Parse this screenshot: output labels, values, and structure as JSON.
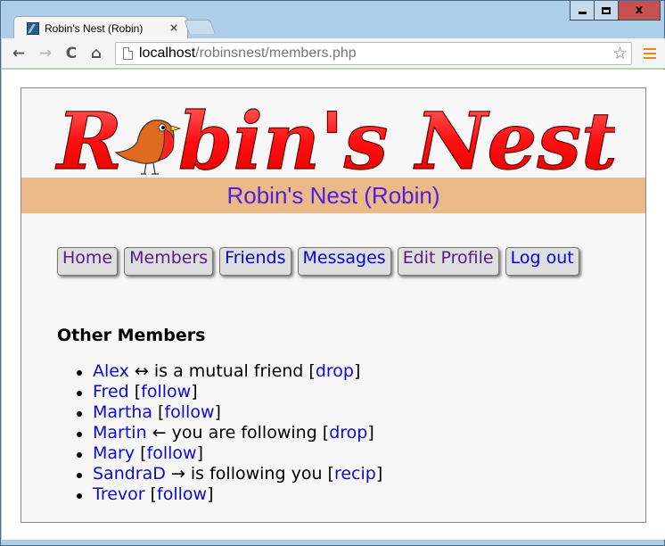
{
  "window": {
    "controls": {
      "minimize": "minimize",
      "maximize": "maximize",
      "close": "x"
    }
  },
  "browser": {
    "tab_title": "Robin's Nest (Robin)",
    "tab_close": "×",
    "url_host": "localhost",
    "url_path": "/robinsnest/members.php",
    "back": "←",
    "forward": "→",
    "reload": "C",
    "home": "⌂",
    "star": "☆"
  },
  "site": {
    "logo_text": "Robin's Nest",
    "logo_first_letter": "R",
    "logo_rest": "bin's Nest",
    "banner": "Robin's Nest (Robin)"
  },
  "nav": [
    {
      "label": "Home",
      "state": "visited"
    },
    {
      "label": "Members",
      "state": "visited"
    },
    {
      "label": "Friends",
      "state": "unvisited"
    },
    {
      "label": "Messages",
      "state": "unvisited"
    },
    {
      "label": "Edit Profile",
      "state": "visited"
    },
    {
      "label": "Log out",
      "state": "unvisited"
    }
  ],
  "section_title": "Other Members",
  "members": [
    {
      "name": "Alex",
      "relation": " ↔ is a mutual friend ",
      "action": "drop"
    },
    {
      "name": "Fred",
      "relation": " ",
      "action": "follow"
    },
    {
      "name": "Martha",
      "relation": " ",
      "action": "follow"
    },
    {
      "name": "Martin",
      "relation": " ← you are following ",
      "action": "drop"
    },
    {
      "name": "Mary",
      "relation": " ",
      "action": "follow"
    },
    {
      "name": "SandraD",
      "relation": " → is following you ",
      "action": "recip"
    },
    {
      "name": "Trevor",
      "relation": " ",
      "action": "follow"
    }
  ],
  "colors": {
    "banner_bg": "#ecba88",
    "banner_text": "#5020e0",
    "link": "#0a0ad8",
    "visited": "#5a1a8a",
    "logo_red": "#ff0000"
  }
}
